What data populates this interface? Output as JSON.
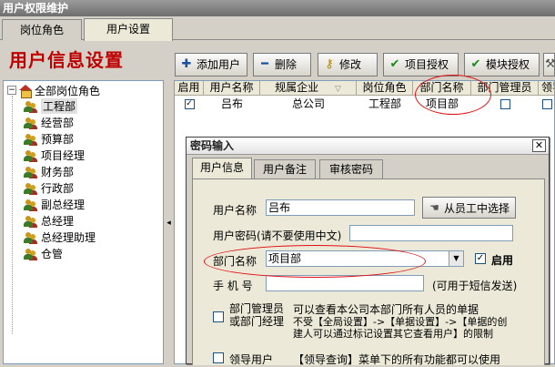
{
  "window": {
    "title": "用户权限维护"
  },
  "top_tabs": [
    {
      "label": "岗位角色"
    },
    {
      "label": "用户设置"
    }
  ],
  "header": {
    "title": "用户信息设置"
  },
  "toolbar": {
    "add_user": "添加用户",
    "delete": "删除",
    "modify": "修改",
    "project_auth": "项目授权",
    "module_auth": "模块授权"
  },
  "tree": {
    "root": "全部岗位角色",
    "items": [
      {
        "label": "工程部"
      },
      {
        "label": "经营部"
      },
      {
        "label": "预算部"
      },
      {
        "label": "项目经理"
      },
      {
        "label": "财务部"
      },
      {
        "label": "行政部"
      },
      {
        "label": "副总经理"
      },
      {
        "label": "总经理"
      },
      {
        "label": "总经理助理"
      },
      {
        "label": "仓管"
      }
    ]
  },
  "grid": {
    "headers": [
      "启用",
      "用户名称",
      "规属企业",
      "岗位角色",
      "部门名称",
      "部门管理员",
      "领导"
    ],
    "rows": [
      {
        "enabled": true,
        "user": "吕布",
        "company": "总公司",
        "role": "工程部",
        "dept": "项目部",
        "dept_admin": false,
        "leader": false
      }
    ]
  },
  "dialog": {
    "title": "密码输入",
    "tabs": [
      {
        "label": "用户信息"
      },
      {
        "label": "用户备注"
      },
      {
        "label": "审核密码"
      }
    ],
    "username_label": "用户名称",
    "username_value": "吕布",
    "from_employee_button": "从员工中选择",
    "password_label": "用户密码(请不要使用中文)",
    "password_value": "",
    "dept_label": "部门名称",
    "dept_value": "项目部",
    "enabled_label": "启用",
    "enabled_checked": true,
    "phone_label": "手  机  号",
    "phone_value": "",
    "phone_hint": "(可用于短信发送)",
    "dept_admin_label_1": "部门管理员",
    "dept_admin_label_2": "或部门经理",
    "dept_admin_checked": false,
    "dept_admin_note_1": "可以查看本公司本部门所有人员的单据",
    "dept_admin_note_2": "不受【全局设置】->【单据设置】->【单据的创",
    "dept_admin_note_3": "建人可以通过标记设置其它查看用户】的限制",
    "leader_label": "领导用户",
    "leader_checked": false,
    "leader_note": "【领导查询】菜单下的所有功能都可以使用"
  },
  "colors": {
    "title_red": "#c00000",
    "annotation_red": "#dd1111"
  }
}
